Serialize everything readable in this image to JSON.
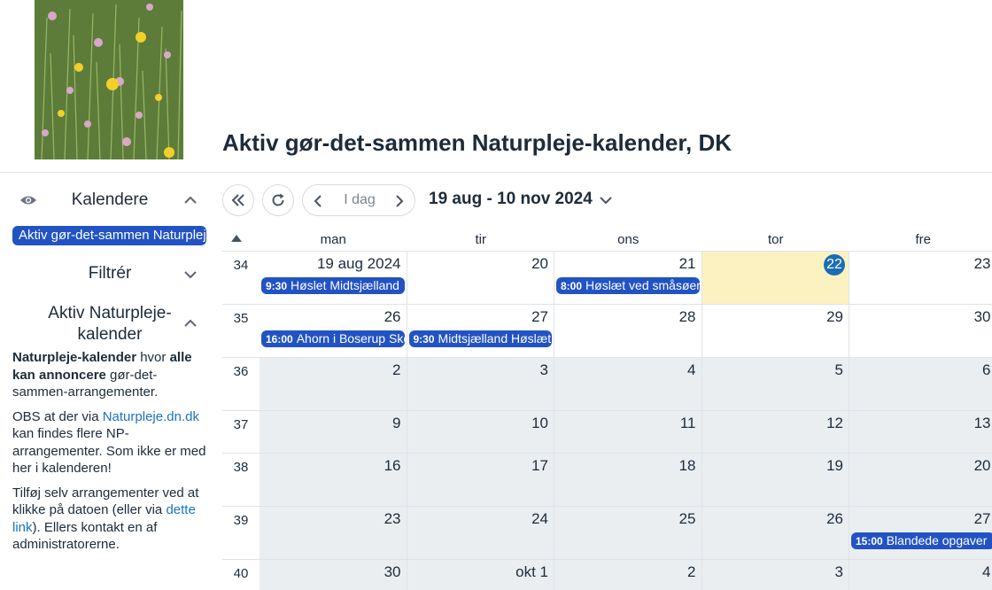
{
  "page": {
    "title": "Aktiv gør-det-sammen Naturpleje-kalender, DK"
  },
  "sidebar": {
    "calendars_heading": "Kalendere",
    "calendar_chip": "Aktiv gør-det-sammen Naturpleje-kalender, DK",
    "filter_heading": "Filtrér",
    "about_heading_1": "Aktiv Naturpleje-",
    "about_heading_2": "kalender",
    "about": {
      "p1_bold1": "Naturpleje-kalender",
      "p1_text1": " hvor ",
      "p1_bold2": "alle kan annoncere",
      "p1_text2": " gør-det-sammen-arrangementer.",
      "p2_text1": "OBS at der via ",
      "p2_link": "Naturpleje.dn.dk",
      "p2_text2": " kan findes flere NP-arrangementer. Som ikke er med her i kalenderen!",
      "p3_text1": "Tilføj selv arrangementer ved at klikke på datoen (eller via ",
      "p3_link": "dette link",
      "p3_text2": "). Ellers kontakt en af administratorerne."
    }
  },
  "toolbar": {
    "today_label": "I dag",
    "range_label": "19 aug - 10 nov 2024",
    "icons": [
      "double-chevron-left-icon",
      "refresh-icon",
      "chevron-left-icon",
      "chevron-right-icon",
      "chevron-down-icon"
    ]
  },
  "calendar": {
    "day_headers": [
      "man",
      "tir",
      "ons",
      "tor",
      "fre"
    ],
    "weeks": [
      {
        "num": "34",
        "days": [
          "19 aug 2024",
          "20",
          "21",
          "22",
          "23"
        ]
      },
      {
        "num": "35",
        "days": [
          "26",
          "27",
          "28",
          "29",
          "30"
        ]
      },
      {
        "num": "36",
        "days": [
          "2",
          "3",
          "4",
          "5",
          "6"
        ]
      },
      {
        "num": "37",
        "days": [
          "9",
          "10",
          "11",
          "12",
          "13"
        ]
      },
      {
        "num": "38",
        "days": [
          "16",
          "17",
          "18",
          "19",
          "20"
        ]
      },
      {
        "num": "39",
        "days": [
          "23",
          "24",
          "25",
          "26",
          "27"
        ]
      },
      {
        "num": "40",
        "days": [
          "30",
          "okt 1",
          "2",
          "3",
          "4"
        ]
      }
    ],
    "events": [
      {
        "time": "9:30",
        "title": "Høslet Midtsjælland"
      },
      {
        "time": "8:00",
        "title": "Høslæt ved småsøer"
      },
      {
        "time": "16:00",
        "title": "Ahorn i Boserup Skov"
      },
      {
        "time": "9:30",
        "title": "Midtsjælland Høslæt"
      },
      {
        "time": "15:00",
        "title": "Blandede opgaver"
      }
    ],
    "colors": {
      "event": "#2253c4",
      "today_cell": "#fcf2c1",
      "today_badge": "#1a6db5",
      "outside_month": "#ebeef1"
    }
  }
}
